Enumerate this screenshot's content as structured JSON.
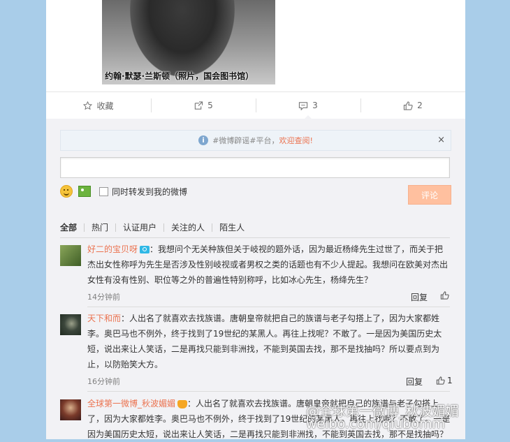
{
  "post": {
    "photo_caption": "约翰·默瑟·兰斯顿（照片，国会图书馆）"
  },
  "actions": [
    {
      "label": "收藏",
      "icon": "star-icon"
    },
    {
      "label": "5",
      "icon": "repost-icon"
    },
    {
      "label": "3",
      "icon": "comment-icon"
    },
    {
      "label": "2",
      "icon": "thumbs-up-icon"
    }
  ],
  "notice": {
    "text": "#微博辟谣#平台，",
    "link": "欢迎查阅!",
    "close": "×"
  },
  "composer": {
    "input_value": "",
    "repost_label": "同时转发到我的微博",
    "submit_label": "评论"
  },
  "filters": [
    "全部",
    "热门",
    "认证用户",
    "关注的人",
    "陌生人"
  ],
  "comments": [
    {
      "name": "好二的宝贝呀",
      "text": "：我想问个无关种族但关于岐视的题外话，因为最近杨绛先生过世了，而关于把杰出女性称呼为先生是否涉及性别岐视或者男权之类的话题也有不少人提起。我想问在欧美对杰出女性有没有性别、职位等之外的普遍性特别称呼，比如冰心先生，杨绛先生？",
      "time": "14分钟前",
      "reply": "回复",
      "likes": "",
      "avatar_color": "#5c7a3a"
    },
    {
      "name": "天下和而",
      "text": "：人出名了就喜欢去找族谱。唐朝皇帝就把自己的族谱与老子勾搭上了，因为大家都姓李。奥巴马也不例外，终于找到了19世纪的某黑人。再往上找呢？不敢了。一是因为美国历史太短，说出来让人笑话，二是再找只能到非洲找，不能到英国去找，那不是找抽吗？所以要点到为止，以防贻笑大方。",
      "time": "16分钟前",
      "reply": "回复",
      "likes": "1",
      "avatar_color": "#3a4a3a"
    },
    {
      "name": "全球第一微博_秋波媚媚",
      "text": "：人出名了就喜欢去找族谱。唐朝皇帝就把自己的族谱与老子勾搭上了，因为大家都姓李。奥巴马也不例外，终于找到了19世纪的某黑人。再往上找呢？不敢了。一是因为美国历史太短，说出来让人笑话，二是再找只能到非洲找，不能到英国去找，那不是找抽吗？",
      "time": "",
      "reply": "",
      "likes": "",
      "avatar_color": "#6a2a2a"
    }
  ],
  "watermark": {
    "line1": "@全球第一微博_秋波媚媚",
    "line2": "weibo.com/qiubomm"
  }
}
